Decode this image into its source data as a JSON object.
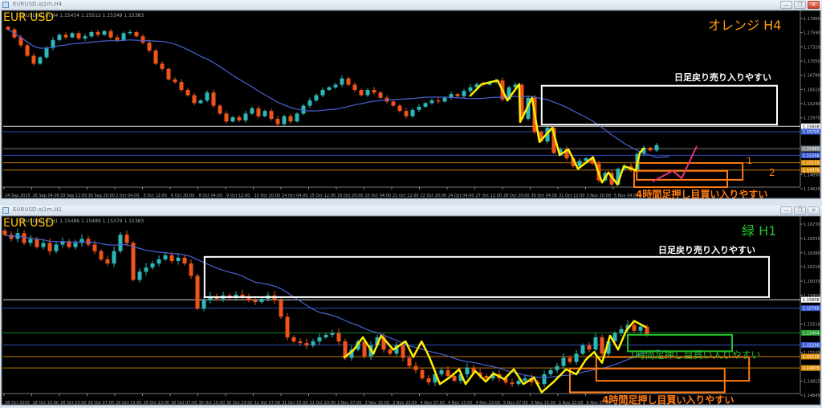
{
  "windows": [
    {
      "title": "EURUSD.oj1m,H4",
      "ohlc": "EURUSD.oj1m,H4  1.15454 1.15512 1.15349 1.15383",
      "symbol_label": "EUR USD",
      "timeframe_label": "オレンジ H4",
      "buttons": {
        "minimize": "—",
        "restore": "❐",
        "close": "✕"
      },
      "annotations": {
        "sell_zone": "日足戻り売り入りやすい",
        "buy_zone_h4": "4時間足押し目買い入りやすい",
        "marker_1": "1",
        "marker_2": "2"
      }
    },
    {
      "title": "EURUSD.oj1m,H1",
      "ohlc": "EURUSD.oj1m,H1  1.15486 1.15489 1.15379 1.15383",
      "symbol_label": "EUR USD",
      "timeframe_label": "緑 H1",
      "buttons": {
        "minimize": "—",
        "restore": "❐",
        "close": "✕"
      },
      "annotations": {
        "sell_zone": "日足戻り売り入りやすい",
        "buy_zone_h1": "1時間足押し目買い入りやすい",
        "buy_zone_h4": "4時間足押し目買い入りやすい"
      }
    }
  ],
  "colors": {
    "background": "#000000",
    "bull_candle": "#2db8b8",
    "bear_candle": "#f0541a",
    "moving_average": "#4a63d8",
    "zigzag": "#ffee00",
    "h4_zone": "#ff7a10",
    "h1_zone": "#22c02a",
    "sell_zone": "#ffffff",
    "projection": "#e8337a",
    "symbol_label": "#ffc000"
  },
  "chart_data": [
    {
      "type": "candlestick",
      "symbol": "EURUSD",
      "timeframe": "H4",
      "grid": false,
      "ylim": [
        1.1462,
        1.1786
      ],
      "y_ticks": [
        "1.17860",
        "1.17590",
        "1.17320",
        "1.17050",
        "1.16780",
        "1.16510",
        "1.16240",
        "1.15970",
        "1.14890",
        "1.14620"
      ],
      "x_ticks": [
        "24 Sep 2025",
        "26 Sep 04:00",
        "29 Sep 12:00",
        "30 Sep 20:00",
        "2 Oct 04:00",
        "3 Oct 12:00",
        "6 Oct 20:00",
        "8 Oct 04:00",
        "9 Oct 12:00",
        "10 Oct 20:00",
        "14 Oct 04:00",
        "15 Oct 12:00",
        "16 Oct 20:00",
        "20 Oct 04:00",
        "21 Oct 12:00",
        "22 Oct 20:00",
        "24 Oct 04:00",
        "27 Oct 12:00",
        "28 Oct 20:00",
        "30 Oct 04:00",
        "31 Oct 12:00",
        "3 Nov 20:00",
        "5 Nov 04:00"
      ],
      "closes": [
        1.1765,
        1.175,
        1.1735,
        1.1715,
        1.17,
        1.1712,
        1.173,
        1.1745,
        1.1755,
        1.175,
        1.1758,
        1.1748,
        1.1752,
        1.176,
        1.1755,
        1.1762,
        1.175,
        1.1745,
        1.1758,
        1.176,
        1.1752,
        1.174,
        1.1725,
        1.17,
        1.169,
        1.167,
        1.1665,
        1.165,
        1.164,
        1.1625,
        1.163,
        1.1645,
        1.162,
        1.1605,
        1.159,
        1.1598,
        1.1592,
        1.1605,
        1.1615,
        1.16,
        1.161,
        1.1595,
        1.1585,
        1.16,
        1.159,
        1.1605,
        1.162,
        1.163,
        1.164,
        1.165,
        1.1655,
        1.166,
        1.1672,
        1.166,
        1.165,
        1.164,
        1.165,
        1.1645,
        1.1635,
        1.1628,
        1.162,
        1.161,
        1.16,
        1.1612,
        1.1618,
        1.1625,
        1.163,
        1.1628,
        1.1635,
        1.1642,
        1.1638,
        1.1648,
        1.1655,
        1.1661,
        1.166,
        1.1665,
        1.1668,
        1.1632,
        1.1655,
        1.166,
        1.1595,
        1.1635,
        1.157,
        1.1552,
        1.1578,
        1.153,
        1.1537,
        1.152,
        1.1505,
        1.1515,
        1.152,
        1.151,
        1.1478,
        1.1492,
        1.147,
        1.15,
        1.1505,
        1.1498,
        1.1528,
        1.154,
        1.1535,
        1.1545
      ],
      "price_lines": [
        {
          "price": "1.15808",
          "color": "#ffffff"
        },
        {
          "price": "1.15705",
          "color": "#3a5cd8"
        },
        {
          "price": "1.15383",
          "color": "#808890"
        },
        {
          "price": "1.15256",
          "color": "#3a5cd8"
        },
        {
          "price": "1.15115",
          "color": "#e0900a"
        },
        {
          "price": "1.14976",
          "color": "#e0900a"
        }
      ],
      "zigzag": [
        [
          71.9,
          1.1638
        ],
        [
          73.75,
          1.1661
        ],
        [
          76.25,
          1.1668
        ],
        [
          77.75,
          1.163
        ],
        [
          79.6,
          1.1661
        ],
        [
          79.75,
          1.1589
        ],
        [
          81.6,
          1.1635
        ],
        [
          82.75,
          1.1551
        ],
        [
          84.75,
          1.1578
        ],
        [
          85.9,
          1.1526
        ],
        [
          87.25,
          1.1537
        ],
        [
          88.75,
          1.15
        ],
        [
          91.1,
          1.1522
        ],
        [
          92.5,
          1.1474
        ],
        [
          93.5,
          1.1493
        ],
        [
          94.9,
          1.147
        ],
        [
          95.9,
          1.1505
        ],
        [
          97.75,
          1.1497
        ],
        [
          98.4,
          1.1531
        ],
        [
          99.1,
          1.154
        ]
      ],
      "projection": [
        [
          100.4,
          1.1476
        ],
        [
          103.5,
          1.1496
        ],
        [
          104.9,
          1.1482
        ],
        [
          107.25,
          1.1543
        ]
      ],
      "zones": [
        {
          "label": "sell_zone",
          "from_bar": 83.1,
          "to_bar": 119.75,
          "high": 1.1658,
          "low": 1.1584,
          "color": "#ffffff"
        },
        {
          "label": "zone_1",
          "from_bar": 97.9,
          "to_bar": 114.4,
          "high": 1.1511,
          "low": 1.1479,
          "color": "#ff7a10"
        },
        {
          "label": "zone_2",
          "from_bar": 97.5,
          "to_bar": 112.0,
          "high": 1.1496,
          "low": 1.1465,
          "color": "#ff7a10"
        }
      ]
    },
    {
      "type": "candlestick",
      "symbol": "EURUSD",
      "timeframe": "H1",
      "grid": false,
      "ylim": [
        1.14645,
        1.1673
      ],
      "y_ticks": [
        "1.16730",
        "1.16555",
        "1.16380",
        "1.16210",
        "1.16035",
        "1.15860",
        "1.15510",
        "1.15165",
        "1.14815",
        "1.14645"
      ],
      "x_ticks": [
        "28 Oct 2025",
        "28 Oct 15:00",
        "28 Oct 23:00",
        "29 Oct 07:00",
        "29 Oct 15:00",
        "29 Oct 23:00",
        "30 Oct 07:00",
        "30 Oct 15:00",
        "30 Oct 23:00",
        "31 Oct 07:00",
        "31 Oct 15:00",
        "31 Oct 23:00",
        "3 Nov 07:00",
        "3 Nov 15:00",
        "3 Nov 23:00",
        "4 Nov 07:00",
        "4 Nov 15:00",
        "4 Nov 23:00",
        "5 Nov 07:00",
        "5 Nov 15:00",
        "5 Nov 23:00",
        "6 Nov 07:00"
      ],
      "closes": [
        1.166,
        1.1655,
        1.1662,
        1.165,
        1.1655,
        1.1645,
        1.165,
        1.164,
        1.1648,
        1.1652,
        1.1645,
        1.165,
        1.1655,
        1.1648,
        1.164,
        1.163,
        1.1625,
        1.164,
        1.166,
        1.165,
        1.1605,
        1.1615,
        1.162,
        1.1625,
        1.163,
        1.1635,
        1.1628,
        1.1632,
        1.1625,
        1.161,
        1.157,
        1.158,
        1.1585,
        1.1582,
        1.1586,
        1.1583,
        1.1587,
        1.1585,
        1.158,
        1.1578,
        1.1582,
        1.1586,
        1.158,
        1.156,
        1.1535,
        1.153,
        1.1528,
        1.1525,
        1.153,
        1.1535,
        1.1538,
        1.154,
        1.153,
        1.151,
        1.152,
        1.153,
        1.1512,
        1.1525,
        1.1535,
        1.152,
        1.1515,
        1.1525,
        1.151,
        1.15,
        1.1495,
        1.1485,
        1.148,
        1.149,
        1.1495,
        1.1488,
        1.1482,
        1.149,
        1.1498,
        1.1492,
        1.1488,
        1.1485,
        1.149,
        1.1485,
        1.148,
        1.1478,
        1.1482,
        1.1485,
        1.148,
        1.1478,
        1.149,
        1.1495,
        1.15,
        1.151,
        1.1505,
        1.1515,
        1.1525,
        1.152,
        1.1535,
        1.1515,
        1.153,
        1.154,
        1.1545,
        1.155,
        1.1543,
        1.1548,
        1.1538
      ],
      "price_lines": [
        {
          "price": "1.15808",
          "color": "#ffffff"
        },
        {
          "price": "1.15705",
          "color": "#3a5cd8"
        },
        {
          "price": "1.15404",
          "color": "#1f9a2a"
        },
        {
          "price": "1.15256",
          "color": "#3a5cd8"
        },
        {
          "price": "1.15115",
          "color": "#e0900a"
        },
        {
          "price": "1.14976",
          "color": "#e0900a"
        }
      ],
      "zigzag": [
        [
          52.75,
          1.151
        ],
        [
          54.25,
          1.1519
        ],
        [
          55.75,
          1.1535
        ],
        [
          57.4,
          1.1515
        ],
        [
          58.6,
          1.1537
        ],
        [
          60.5,
          1.152
        ],
        [
          62.4,
          1.153
        ],
        [
          63.6,
          1.1511
        ],
        [
          64.9,
          1.153
        ],
        [
          66.1,
          1.1511
        ],
        [
          67.75,
          1.1478
        ],
        [
          69.25,
          1.1486
        ],
        [
          70.75,
          1.1496
        ],
        [
          71.75,
          1.1478
        ],
        [
          73.25,
          1.1494
        ],
        [
          74.9,
          1.1481
        ],
        [
          76.1,
          1.1491
        ],
        [
          77.75,
          1.1484
        ],
        [
          79.25,
          1.1496
        ],
        [
          80.75,
          1.1478
        ],
        [
          82.4,
          1.1486
        ],
        [
          83.6,
          1.1468
        ],
        [
          85.5,
          1.1481
        ],
        [
          87.4,
          1.1496
        ],
        [
          89.0,
          1.149
        ],
        [
          90.5,
          1.1508
        ],
        [
          91.75,
          1.1517
        ],
        [
          93.0,
          1.1504
        ],
        [
          94.25,
          1.1537
        ],
        [
          95.5,
          1.152
        ],
        [
          96.75,
          1.1543
        ],
        [
          98.0,
          1.1555
        ],
        [
          99.9,
          1.1547
        ]
      ],
      "zones": [
        {
          "label": "sell_zone",
          "from_bar": 31.1,
          "to_bar": 119.0,
          "high": 1.1633,
          "low": 1.1584,
          "color": "#ffffff"
        },
        {
          "label": "h1_buy_zone",
          "from_bar": 97.0,
          "to_bar": 113.25,
          "high": 1.1538,
          "low": 1.1518,
          "color": "#22c02a"
        },
        {
          "label": "h4_zone_1",
          "from_bar": 92.1,
          "to_bar": 115.9,
          "high": 1.1511,
          "low": 1.1482,
          "color": "#ff7a10"
        },
        {
          "label": "h4_zone_2",
          "from_bar": 88.0,
          "to_bar": 112.1,
          "high": 1.1497,
          "low": 1.1468,
          "color": "#ff7a10"
        }
      ]
    }
  ]
}
